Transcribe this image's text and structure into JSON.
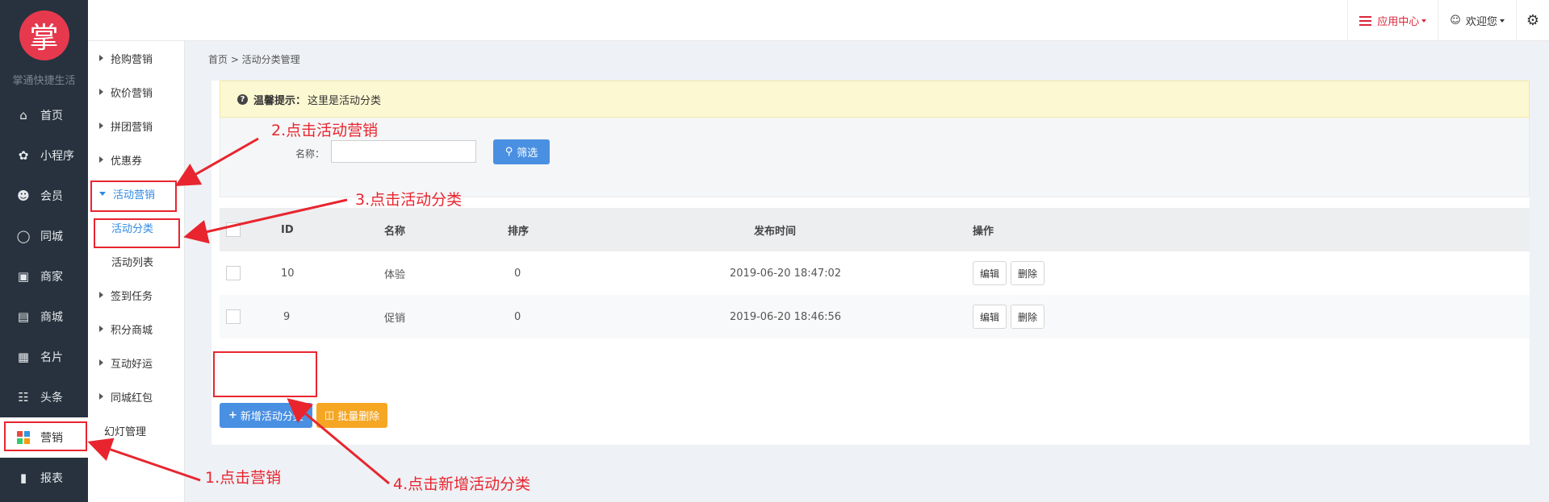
{
  "sidebar": {
    "logo_char": "掌",
    "brand": "掌通快捷生活",
    "items": [
      {
        "label": "首页",
        "icon": "home-icon"
      },
      {
        "label": "小程序",
        "icon": "miniapp-icon"
      },
      {
        "label": "会员",
        "icon": "user-icon"
      },
      {
        "label": "同城",
        "icon": "ring-icon"
      },
      {
        "label": "商家",
        "icon": "store-icon"
      },
      {
        "label": "商城",
        "icon": "shop-icon"
      },
      {
        "label": "名片",
        "icon": "card-icon"
      },
      {
        "label": "头条",
        "icon": "news-icon"
      },
      {
        "label": "营销",
        "icon": "grid-icon"
      },
      {
        "label": "报表",
        "icon": "chart-icon"
      }
    ]
  },
  "subnav": {
    "items": [
      "抢购营销",
      "砍价营销",
      "拼团营销",
      "优惠券"
    ],
    "open_item": "活动营销",
    "children": [
      "活动分类",
      "活动列表"
    ],
    "more_items": [
      "签到任务",
      "积分商城",
      "互动好运",
      "同城红包"
    ],
    "plain_item": "幻灯管理"
  },
  "topbar": {
    "app_center": "应用中心",
    "welcome": "欢迎您"
  },
  "breadcrumb": "首页 > 活动分类管理",
  "tip": {
    "label": "温馨提示：",
    "text": "这里是活动分类"
  },
  "filter": {
    "label": "名称：",
    "value": "",
    "button": "筛选"
  },
  "table": {
    "headers": [
      "ID",
      "名称",
      "排序",
      "发布时间",
      "操作"
    ],
    "rows": [
      {
        "id": "10",
        "name": "体验",
        "sort": "0",
        "time": "2019-06-20 18:47:02",
        "edit": "编辑",
        "delete": "删除"
      },
      {
        "id": "9",
        "name": "促销",
        "sort": "0",
        "time": "2019-06-20 18:46:56",
        "edit": "编辑",
        "delete": "删除"
      }
    ]
  },
  "actions": {
    "add": "新增活动分类",
    "batch_delete": "批量删除"
  },
  "annotations": {
    "step1": "1.点击营销",
    "step2": "2.点击活动营销",
    "step3": "3.点击活动分类",
    "step4": "4.点击新增活动分类"
  },
  "colors": {
    "sidebar_bg": "#27323e",
    "accent_blue": "#4a90e2",
    "accent_orange": "#f5a623",
    "annotation_red": "#e8252f",
    "logo_red": "#e6394d"
  }
}
